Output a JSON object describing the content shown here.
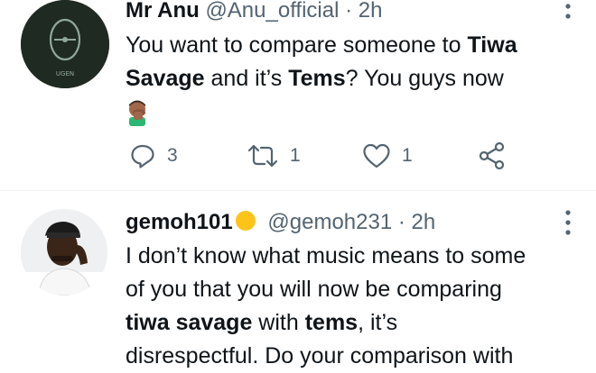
{
  "tweet1": {
    "name": "Mr Anu",
    "handle": "@Anu_official",
    "separator": "·",
    "time": "2h",
    "text_line1_a": "You want to compare someone to ",
    "text_line1_b": "Tiwa",
    "text_line2_a": "Savage",
    "text_line2_b": " and it’s ",
    "text_line2_c": "Tems",
    "text_line2_d": "? You guys now",
    "emoji": "man-facepalming-emoji",
    "replies": "3",
    "retweets": "1",
    "likes": "1",
    "avatar_text": "Θ",
    "avatar_subtext": "UGEN",
    "avatar_color": "#1f2a22"
  },
  "tweet2": {
    "name": "gemoh101",
    "badge": "yellow-circle-emoji",
    "handle": "@gemoh231",
    "separator": "·",
    "time": "2h",
    "line1": "I don’t know what music means to some",
    "line2": "of you that you will now be comparing",
    "line3_a": "tiwa savage",
    "line3_b": " with ",
    "line3_c": "tems",
    "line3_d": ", it’s",
    "line4": "disrespectful. Do your comparison with"
  },
  "colors": {
    "text": "#0f1419",
    "muted": "#536471",
    "divider": "#eff3f4",
    "badge": "#fcc419"
  },
  "icons": [
    "reply-icon",
    "retweet-icon",
    "like-icon",
    "share-icon",
    "more-icon"
  ]
}
